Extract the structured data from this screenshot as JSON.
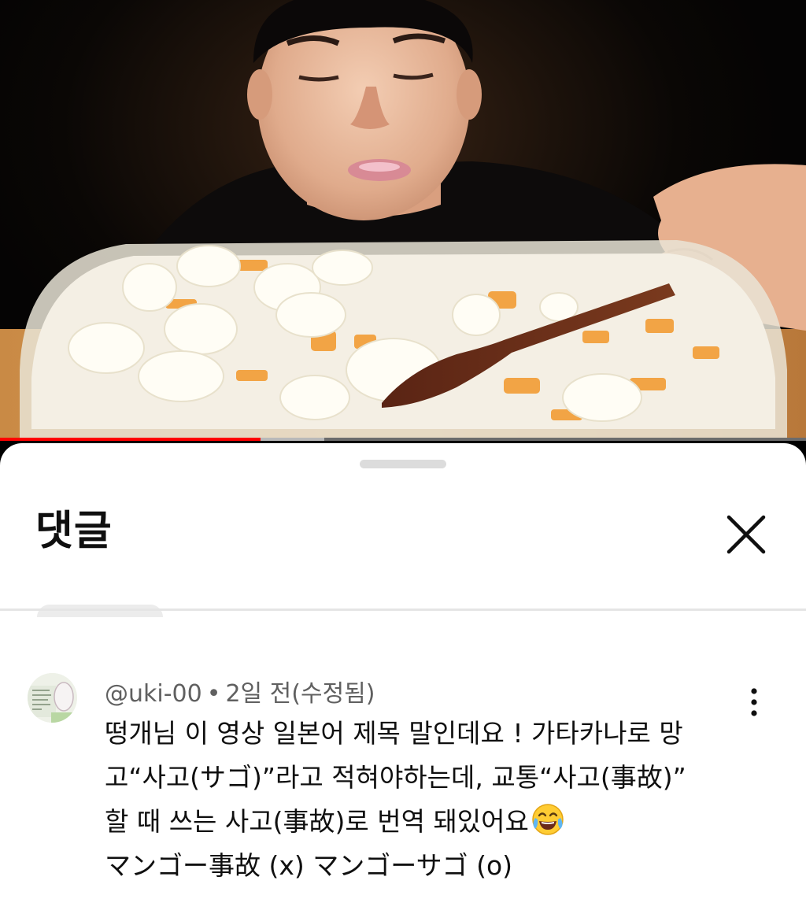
{
  "video": {
    "progress_fraction": 0.323,
    "buffered_fraction": 0.402,
    "accent_color": "#ff0000"
  },
  "comments_panel": {
    "title": "댓글",
    "close_icon": "close-icon",
    "comment": {
      "author": "@uki-00",
      "separator": "•",
      "time": "2일 전(수정됨)",
      "lines": [
        "떵개님 이 영상 일본어 제목 말인데요 ! 가타카나로 망",
        "고“사고(サゴ)”라고 적혀야하는데,  교통“사고(事故)”",
        "할 때 쓰는 사고(事故)로 번역 돼있어요",
        "マンゴー事故 (x)  マンゴーサゴ (o)"
      ],
      "emoji": "laughing-crying-emoji",
      "menu_icon": "more-vert-icon"
    }
  }
}
